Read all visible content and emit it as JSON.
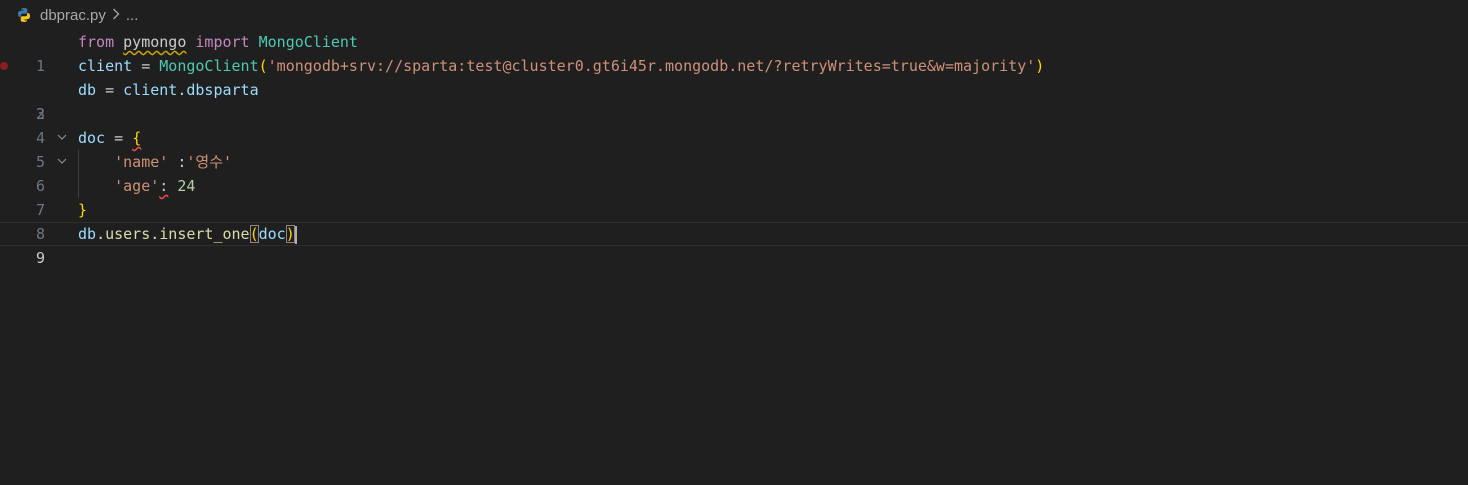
{
  "breadcrumb": {
    "file": "dbprac.py",
    "ellipsis": "..."
  },
  "colors": {
    "background": "#1f1f1f",
    "keyword": "#c586c0",
    "variable": "#9cdcfe",
    "class": "#4ec9b0",
    "string": "#ce9178",
    "number": "#b5cea8",
    "bracket": "#ffd700",
    "breakpoint": "#8a1f1f"
  },
  "gutter": {
    "numbers": [
      "1",
      "2",
      "3",
      "4",
      "5",
      "6",
      "7",
      "8",
      "9"
    ]
  },
  "code": {
    "l1": {
      "from": "from",
      "module": "pymongo",
      "import": "import",
      "cls": "MongoClient"
    },
    "l2": {
      "var": "client",
      "eq": " = ",
      "cls": "MongoClient",
      "open": "(",
      "str": "'mongodb+srv://sparta:test@cluster0.gt6i45r.mongodb.net/?retryWrites=true&w=majority'",
      "close": ")"
    },
    "l3": {
      "var": "db",
      "eq": " = ",
      "obj": "client",
      "attr": ".dbsparta"
    },
    "l5": {
      "var": "doc",
      "eq": " = ",
      "brace": "{"
    },
    "l6": {
      "indent": "    ",
      "key": "'name'",
      "colon": " :",
      "val": "'영수'"
    },
    "l7": {
      "indent": "    ",
      "key": "'age'",
      "colon": ":",
      "num": " 24"
    },
    "l8": {
      "brace": "}"
    },
    "l9": {
      "obj": "db",
      "attr": ".users.insert_one",
      "open": "(",
      "arg": "doc",
      "close": ")"
    }
  }
}
